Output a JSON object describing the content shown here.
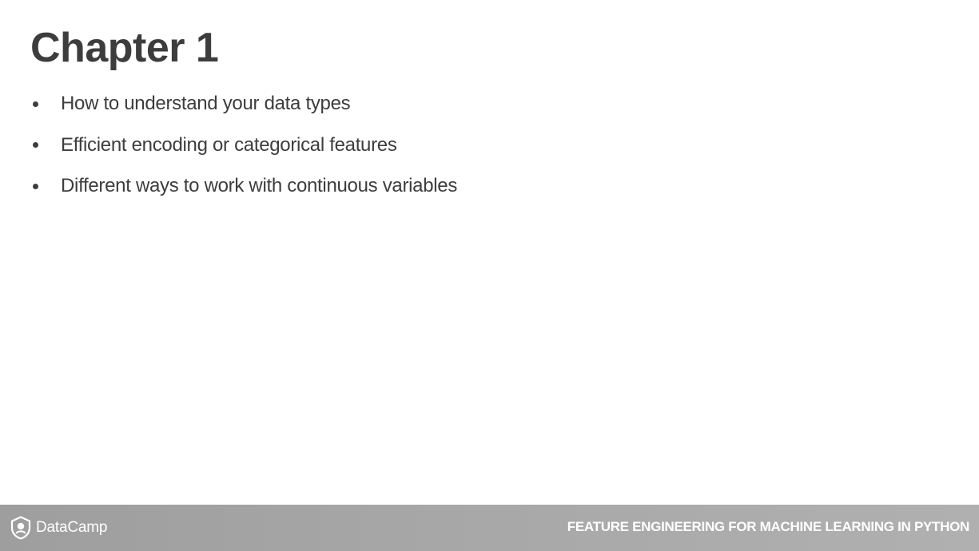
{
  "slide": {
    "title": "Chapter 1",
    "bullets": [
      "How to understand your data types",
      "Efficient encoding or categorical features",
      "Different ways to work with continuous variables"
    ]
  },
  "footer": {
    "logo_text": "DataCamp",
    "logo_icon": "datacamp-shield-icon",
    "course_title": "FEATURE ENGINEERING FOR MACHINE LEARNING IN PYTHON"
  },
  "colors": {
    "text": "#3d3d3d",
    "footer_bar": "#a8a8a8",
    "footer_text": "#ffffff"
  }
}
